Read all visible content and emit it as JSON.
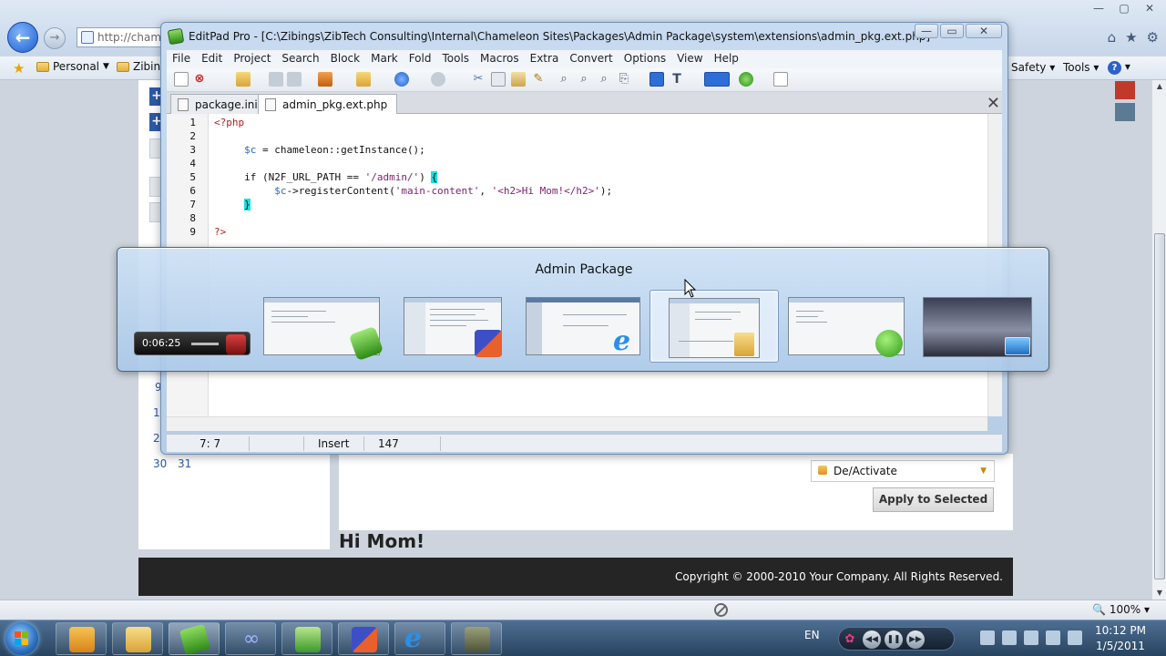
{
  "browser": {
    "address_text": "http://chame",
    "favorites": [
      {
        "label": "Personal"
      },
      {
        "label": "Zibin"
      }
    ],
    "command_bar": {
      "safety": "Safety",
      "tools": "Tools"
    },
    "window_controls": {
      "minimize": "—",
      "maximize": "▢",
      "close": "✕"
    }
  },
  "site": {
    "left_buttons": [
      "+",
      "+"
    ],
    "calendar_partial": [
      "9",
      "1",
      "2"
    ],
    "calendar_last_row": [
      "30",
      "31"
    ],
    "dropdown_label": "De/Activate",
    "apply_button": "Apply to Selected",
    "hi_mom": "Hi Mom!",
    "footer": "Copyright © 2000-2010 Your Company. All Rights Reserved.",
    "swatches": [
      "#c0392b",
      "#5b7a93"
    ]
  },
  "editpad": {
    "title": "EditPad Pro - [C:\\Zibings\\ZibTech Consulting\\Internal\\Chameleon Sites\\Packages\\Admin Package\\system\\extensions\\admin_pkg.ext.php]",
    "window_controls": {
      "minimize": "—",
      "restore": "▭",
      "close": "✕"
    },
    "menu": [
      "File",
      "Edit",
      "Project",
      "Search",
      "Block",
      "Mark",
      "Fold",
      "Tools",
      "Macros",
      "Extra",
      "Convert",
      "Options",
      "View",
      "Help"
    ],
    "tabs": [
      {
        "label": "package.ini",
        "active": false
      },
      {
        "label": "admin_pkg.ext.php",
        "active": true
      }
    ],
    "tab_close": "✕",
    "line_numbers": [
      "1",
      "2",
      "3",
      "4",
      "5",
      "6",
      "7",
      "8",
      "9"
    ],
    "status": {
      "position": "7: 7",
      "mode": "Insert",
      "count": "147"
    }
  },
  "switcher": {
    "title": "Admin Package",
    "player_time": "0:06:25",
    "items": [
      {
        "name": "media-player"
      },
      {
        "name": "editpad-pro"
      },
      {
        "name": "editor-mixed"
      },
      {
        "name": "internet-explorer"
      },
      {
        "name": "windows-explorer"
      },
      {
        "name": "green-app"
      },
      {
        "name": "desktop"
      }
    ]
  },
  "taskbar": {
    "language": "EN",
    "time": "10:12 PM",
    "date": "1/5/2011"
  },
  "statusbar": {
    "zoom": "100%"
  }
}
